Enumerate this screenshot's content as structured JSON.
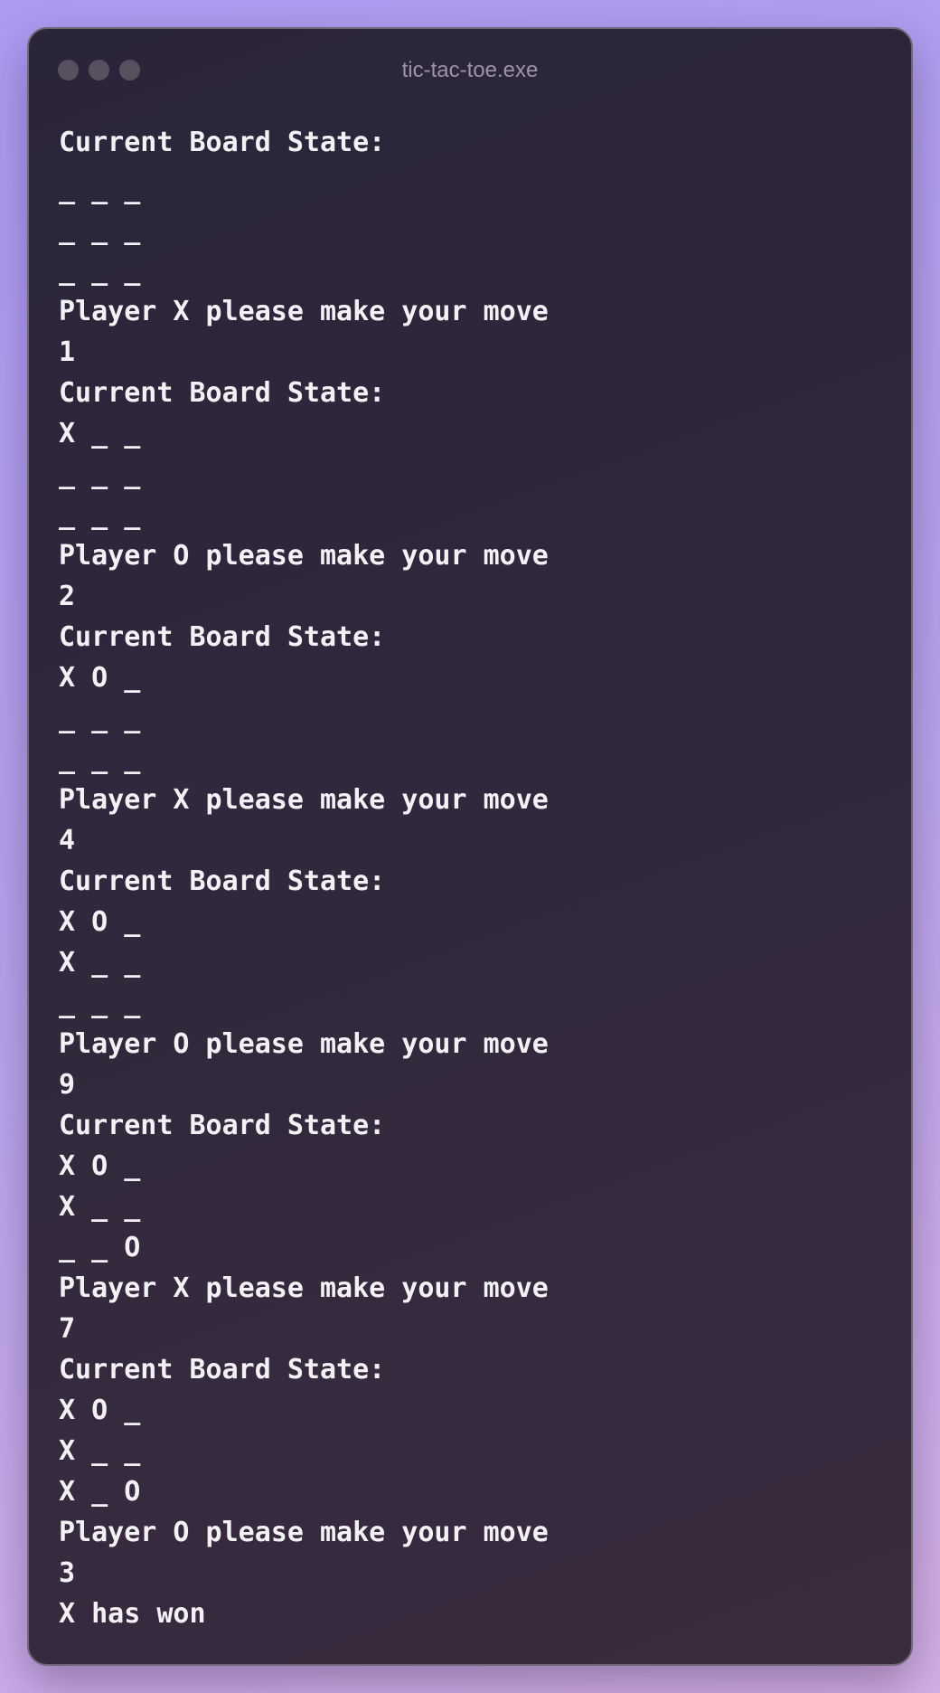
{
  "window": {
    "title": "tic-tac-toe.exe"
  },
  "terminal": {
    "lines": [
      "Current Board State:",
      "_ _ _",
      "_ _ _",
      "_ _ _",
      "Player X please make your move",
      "1",
      "Current Board State:",
      "X _ _",
      "_ _ _",
      "_ _ _",
      "Player O please make your move",
      "2",
      "Current Board State:",
      "X O _",
      "_ _ _",
      "_ _ _",
      "Player X please make your move",
      "4",
      "Current Board State:",
      "X O _",
      "X _ _",
      "_ _ _",
      "Player O please make your move",
      "9",
      "Current Board State:",
      "X O _",
      "X _ _",
      "_ _ O",
      "Player X please make your move",
      "7",
      "Current Board State:",
      "X O _",
      "X _ _",
      "X _ O",
      "Player O please make your move",
      "3",
      "X has won"
    ]
  }
}
